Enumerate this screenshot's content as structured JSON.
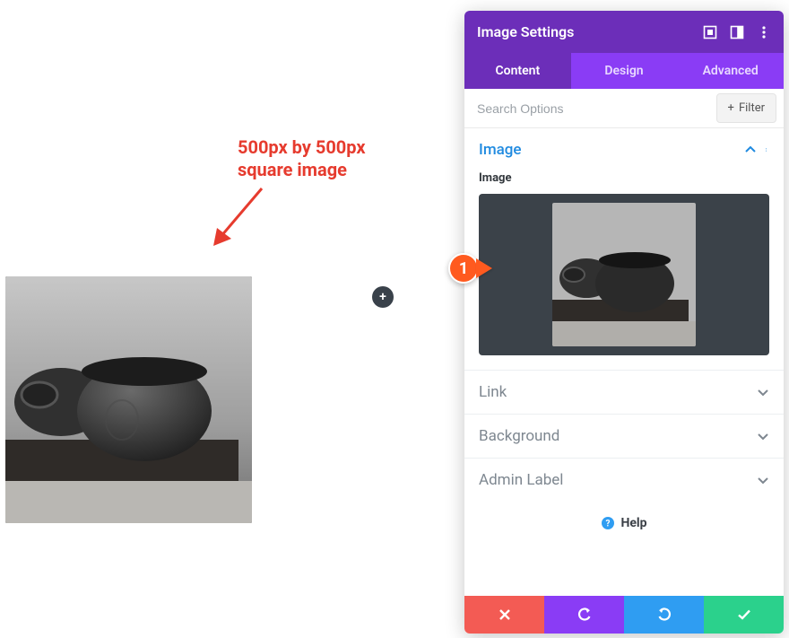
{
  "annotation": {
    "text": "500px by 500px\nsquare image"
  },
  "callout": {
    "label": "1"
  },
  "addButton": {
    "glyph": "+"
  },
  "panel": {
    "title": "Image Settings",
    "tabs": {
      "content": "Content",
      "design": "Design",
      "advanced": "Advanced"
    },
    "search": {
      "placeholder": "Search Options"
    },
    "filter": {
      "label": "Filter",
      "plus": "+"
    },
    "sections": {
      "image": {
        "title": "Image",
        "fieldLabel": "Image"
      },
      "link": {
        "title": "Link"
      },
      "background": {
        "title": "Background"
      },
      "adminLabel": {
        "title": "Admin Label"
      }
    },
    "help": {
      "label": "Help"
    }
  },
  "colors": {
    "purpleHeader": "#6c2eb9",
    "purpleTabs": "#8a3cf5",
    "sectionOpen": "#1f8ae0",
    "cancel": "#f35b54",
    "save": "#2bd18c",
    "redo": "#2f9df2",
    "calloutOrange": "#ff5a1f",
    "annotationRed": "#e63b2e"
  }
}
